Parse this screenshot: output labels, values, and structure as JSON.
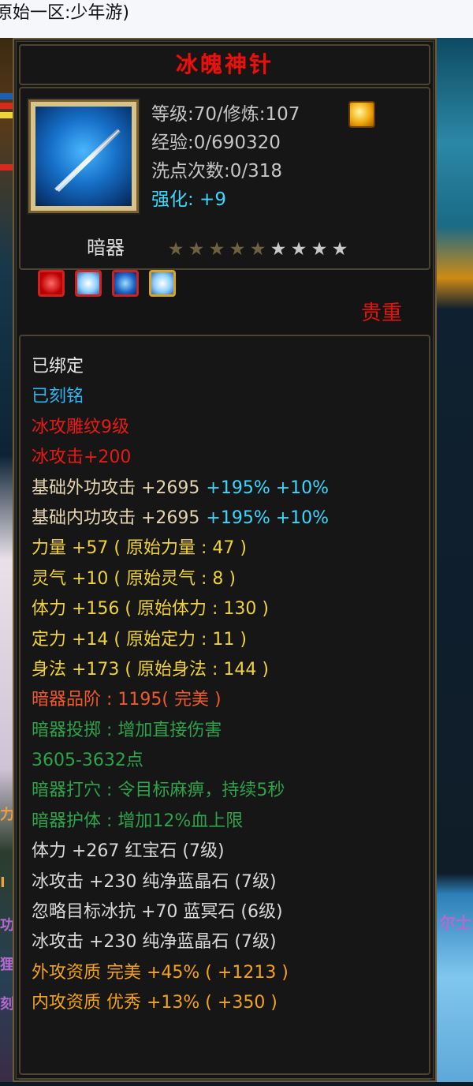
{
  "page": {
    "breadcrumb": "原始一区:少年游)"
  },
  "item": {
    "name": "冰魄神针",
    "level_line": "等级:70/修炼:107",
    "exp_line": "经验:0/690320",
    "wash_line": "洗点次数:0/318",
    "enhance_line": "强化: +9",
    "type": "暗器",
    "stars_filled": 5,
    "stars_total": 9,
    "rarity": "贵重",
    "gems": [
      "red-gem-icon",
      "ice-gem-icon",
      "blue-gem-icon",
      "ice-gem-gold-icon"
    ]
  },
  "background_text": {
    "right_fragment": "尔士",
    "left_fragments": [
      "力",
      "I",
      "功",
      "狸",
      "刻"
    ]
  },
  "stats": [
    {
      "text": "已绑定",
      "color": "white"
    },
    {
      "text": "已刻铭",
      "color": "blue"
    },
    {
      "text": "冰攻雕纹9级",
      "color": "red"
    },
    {
      "text": "冰攻击+200",
      "color": "red"
    },
    {
      "text": "基础外功攻击 +2695",
      "color": "cream",
      "extra": "+195% +10%",
      "extra_color": "cyan"
    },
    {
      "text": "基础内功攻击 +2695",
      "color": "cream",
      "extra": "+195% +10%",
      "extra_color": "cyan"
    },
    {
      "text": "力量 +57 ( 原始力量 : 47 )",
      "color": "yellow"
    },
    {
      "text": "灵气 +10 ( 原始灵气 : 8 )",
      "color": "yellow"
    },
    {
      "text": "体力 +156 ( 原始体力 : 130 )",
      "color": "yellow"
    },
    {
      "text": "定力 +14 ( 原始定力 : 11 )",
      "color": "yellow"
    },
    {
      "text": "身法 +173 ( 原始身法 : 144 )",
      "color": "yellow"
    },
    {
      "text": "暗器品阶 : 1195( 完美 )",
      "color": "orange"
    },
    {
      "text": "暗器投掷 : 增加直接伤害",
      "color": "green"
    },
    {
      "text": "3605-3632点",
      "color": "green"
    },
    {
      "text": "暗器打穴 : 令目标麻痹，持续5秒",
      "color": "green"
    },
    {
      "text": "暗器护体 : 增加12%血上限",
      "color": "green"
    },
    {
      "text": "体力 +267 红宝石 (7级)",
      "color": "light"
    },
    {
      "text": "冰攻击 +230 纯净蓝晶石 (7级)",
      "color": "light"
    },
    {
      "text": "忽略目标冰抗 +70 蓝冥石 (6级)",
      "color": "light"
    },
    {
      "text": "冰攻击 +230 纯净蓝晶石 (7级)",
      "color": "light"
    },
    {
      "text": "外攻资质   完美 +45% ( +1213 )",
      "color": "gold"
    },
    {
      "text": "内攻资质   优秀 +13% ( +350 )",
      "color": "gold"
    }
  ],
  "colors": {
    "title": "#e3140d",
    "rarity": "#e3140d",
    "enhance": "#3ad7ff",
    "panel_bg": "#141414",
    "border": "#4b4433"
  }
}
